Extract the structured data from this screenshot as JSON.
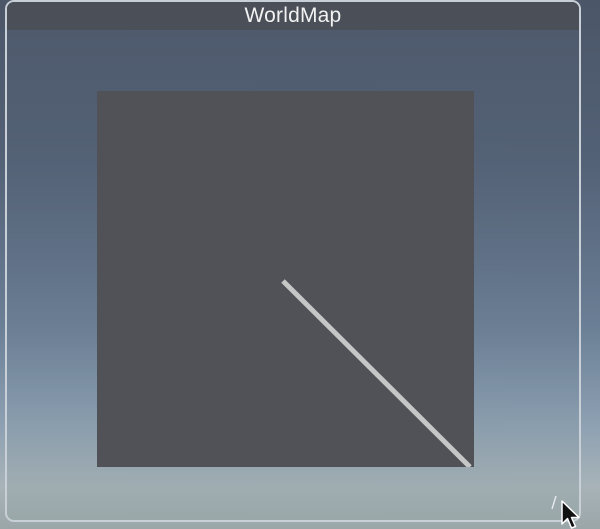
{
  "window": {
    "title": "WorldMap"
  },
  "icons": {
    "resize_handle": "resize-handle-icon",
    "cursor": "mouse-pointer-icon"
  },
  "colors": {
    "title_bar": "#4a4f58",
    "map_background": "#505257",
    "map_line": "#c6c6c6",
    "window_border": "#c9cfd6"
  }
}
